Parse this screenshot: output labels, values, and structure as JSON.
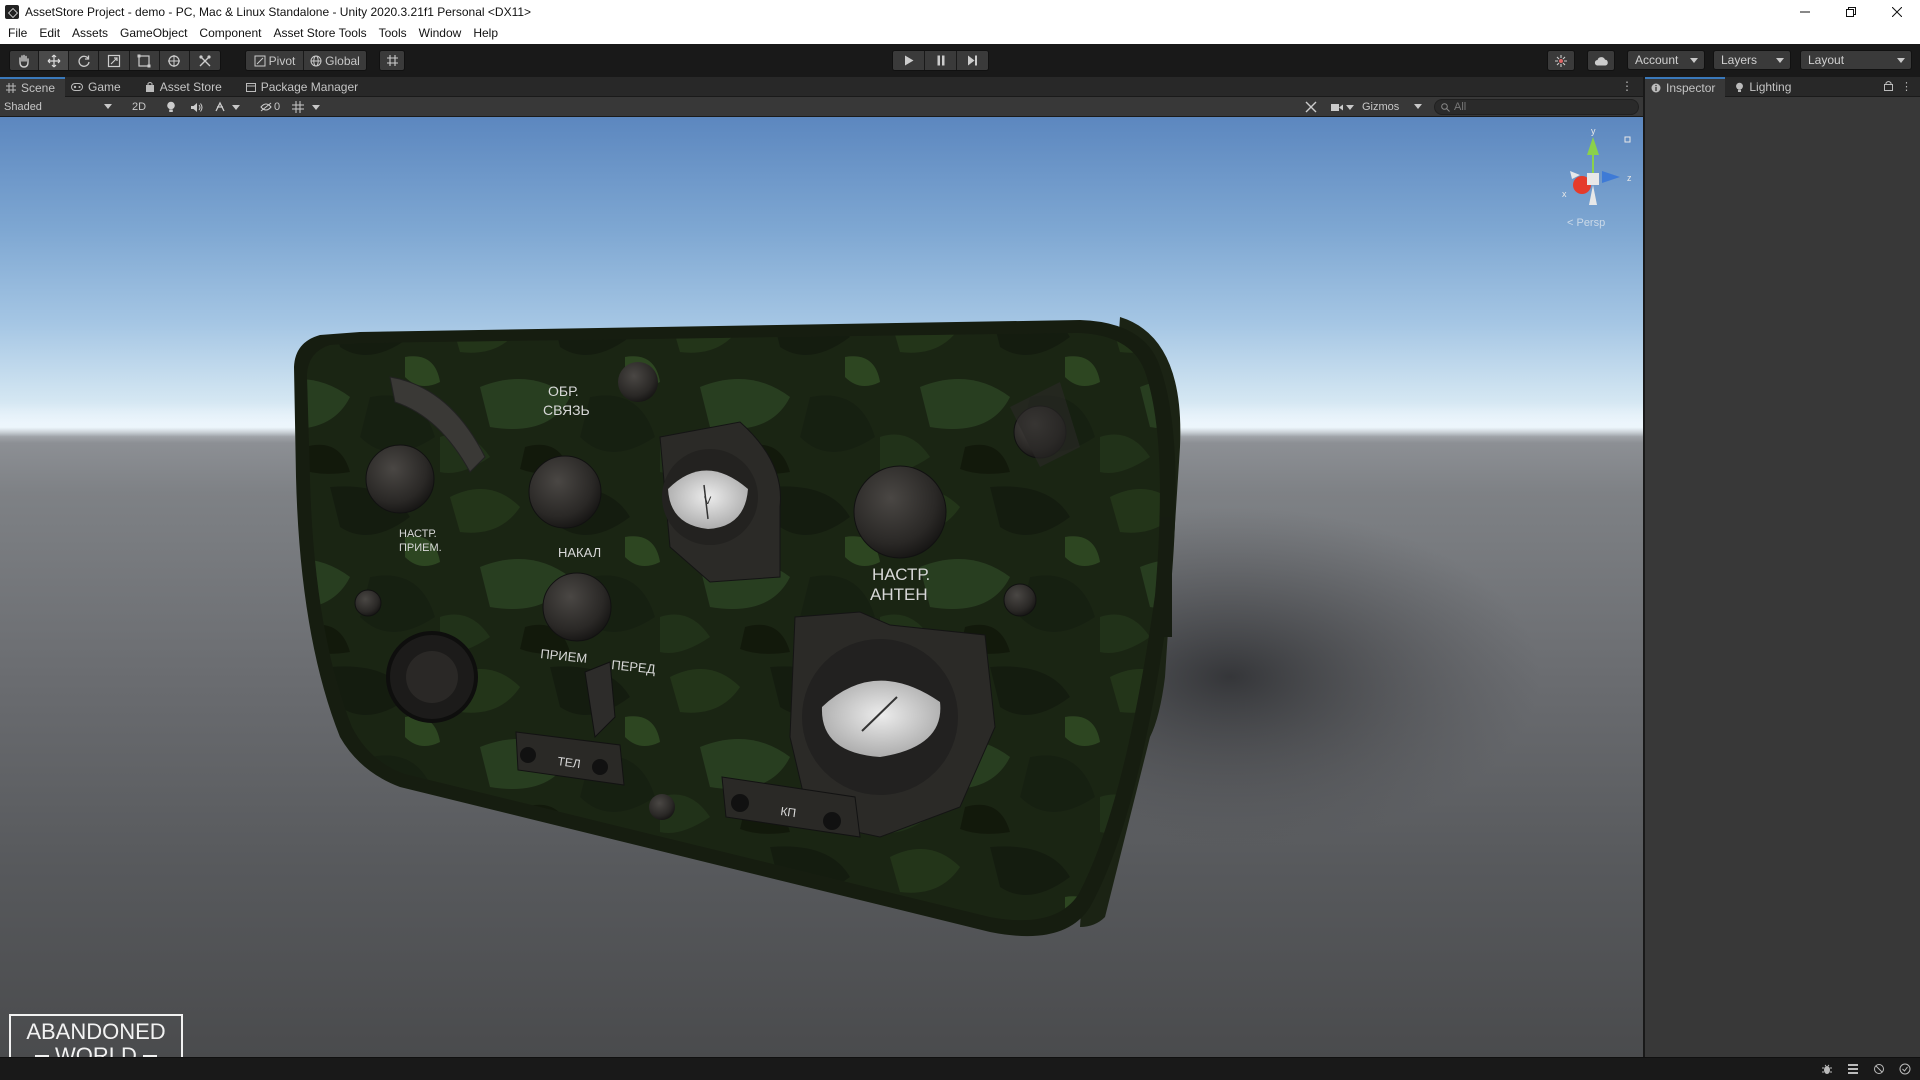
{
  "window": {
    "title": "AssetStore Project - demo - PC, Mac & Linux Standalone - Unity 2020.3.21f1 Personal <DX11>",
    "controls": [
      "minimize-icon",
      "restore-icon",
      "close-icon"
    ]
  },
  "menu": [
    "File",
    "Edit",
    "Assets",
    "GameObject",
    "Component",
    "Asset Store Tools",
    "Tools",
    "Window",
    "Help"
  ],
  "toolbar": {
    "tools": [
      "hand-tool-icon",
      "move-tool-icon",
      "rotate-tool-icon",
      "scale-tool-icon",
      "rect-tool-icon",
      "transform-tool-icon",
      "custom-tool-icon"
    ],
    "pivot_label": "Pivot",
    "global_label": "Global",
    "account_label": "Account",
    "layers_label": "Layers",
    "layout_label": "Layout"
  },
  "scene_tabs": [
    "Scene",
    "Game",
    "Asset Store",
    "Package Manager"
  ],
  "scene_toolbar": {
    "shading_mode": "Shaded",
    "mode_2d": "2D",
    "hidden_count": "0",
    "gizmos_label": "Gizmos",
    "search_placeholder": "All"
  },
  "viewport": {
    "projection_label": "< Persp",
    "axis_labels": {
      "y": "y",
      "x": "x",
      "z": "z"
    },
    "panel_labels": [
      "ОБР.",
      "СВЯЗЬ",
      "НАСТР.",
      "ПРИЕМ.",
      "НАКАЛ",
      "ПРИЕМ",
      "ПЕРЕД",
      "НАСТР.",
      "АНТЕН",
      "ТЕЛ",
      "КП",
      "V"
    ],
    "watermark": {
      "line1": "ABANDONED",
      "line2": "WORLD"
    }
  },
  "right_panel": {
    "tabs": [
      "Inspector",
      "Lighting"
    ]
  },
  "colors": {
    "accent": "#3a79bb",
    "editor_bg": "#383838",
    "toolbar_bg": "#191919",
    "camo_dark": "#1e2a16",
    "camo_light": "#3c5a26"
  }
}
